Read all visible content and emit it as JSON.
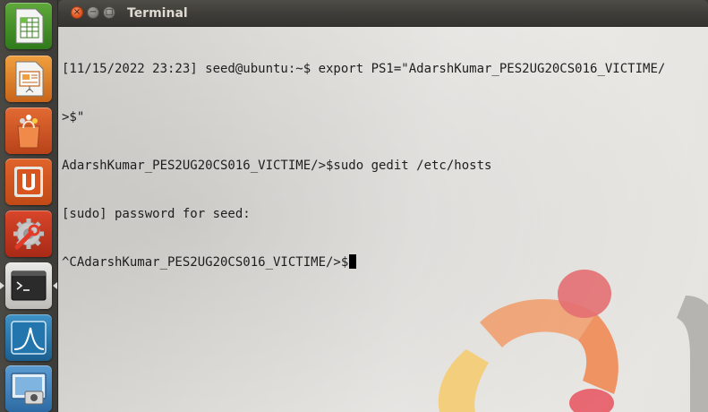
{
  "launcher": {
    "items": [
      {
        "name": "spreadsheet-app",
        "icon": "spreadsheet-icon"
      },
      {
        "name": "presentation-app",
        "icon": "presentation-icon"
      },
      {
        "name": "software-center",
        "icon": "shopping-bag-icon"
      },
      {
        "name": "ubuntu-one",
        "icon": "ubuntu-one-icon"
      },
      {
        "name": "system-settings",
        "icon": "settings-wrench-icon"
      },
      {
        "name": "terminal",
        "icon": "terminal-icon",
        "active": true
      },
      {
        "name": "wireshark",
        "icon": "wireshark-fin-icon"
      },
      {
        "name": "screenshot",
        "icon": "camera-screen-icon"
      }
    ]
  },
  "window": {
    "title": "Terminal",
    "buttons": {
      "close": "×",
      "minimize": "−",
      "maximize": "□"
    }
  },
  "terminal": {
    "lines": [
      "[11/15/2022 23:23] seed@ubuntu:~$ export PS1=\"AdarshKumar_PES2UG20CS016_VICTIME/",
      ">$\"",
      "AdarshKumar_PES2UG20CS016_VICTIME/>$sudo gedit /etc/hosts",
      "[sudo] password for seed:",
      "^CAdarshKumar_PES2UG20CS016_VICTIME/>$"
    ]
  },
  "colors": {
    "close_button": "#e45a24",
    "terminal_text": "#1e1e1e",
    "titlebar": "#3d3c38"
  }
}
